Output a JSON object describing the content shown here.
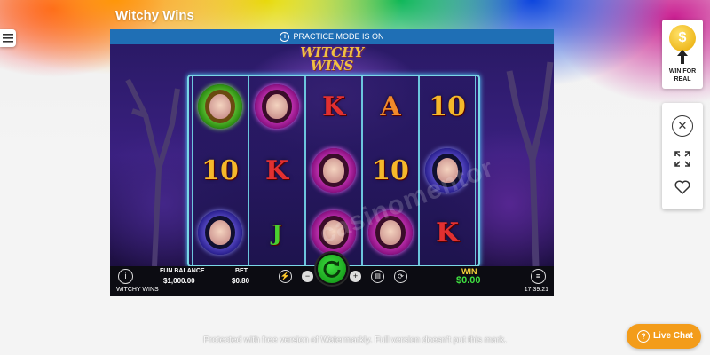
{
  "site": {
    "title": "Witchy Wins"
  },
  "game": {
    "practice_notice": "PRACTICE MODE IS ON",
    "logo_text": "WITCHY WINS",
    "watermark": "casinomentor",
    "reels": [
      [
        "witch-green",
        "10",
        "witch-purple"
      ],
      [
        "witch-pink",
        "K",
        "J"
      ],
      [
        "K",
        "witch-pink",
        "witch-pink"
      ],
      [
        "A",
        "10",
        "witch-pink"
      ],
      [
        "10",
        "witch-purple",
        "K"
      ]
    ],
    "controls": {
      "info_icon": "info-icon",
      "fun_balance_label": "FUN BALANCE",
      "fun_balance_value": "$1,000.00",
      "bet_label": "BET",
      "bet_value": "$0.80",
      "win_label": "WIN",
      "win_value": "$0.00",
      "game_name": "WITCHY WINS",
      "clock": "17:39:21"
    }
  },
  "sidebar": {
    "win_for_real": "WIN FOR REAL",
    "coin_symbol": "$"
  },
  "footer": {
    "protected_text": "Protected with free version of Watermarkly. Full version doesn't put this mark."
  },
  "chat": {
    "label": "Live Chat",
    "icon": "question-icon"
  },
  "colors": {
    "practice_bar": "#1f6fb5",
    "spin_button": "#22c02a",
    "win_label": "#f7d23a",
    "win_value": "#3fe040",
    "live_chat": "#f39c1a"
  }
}
